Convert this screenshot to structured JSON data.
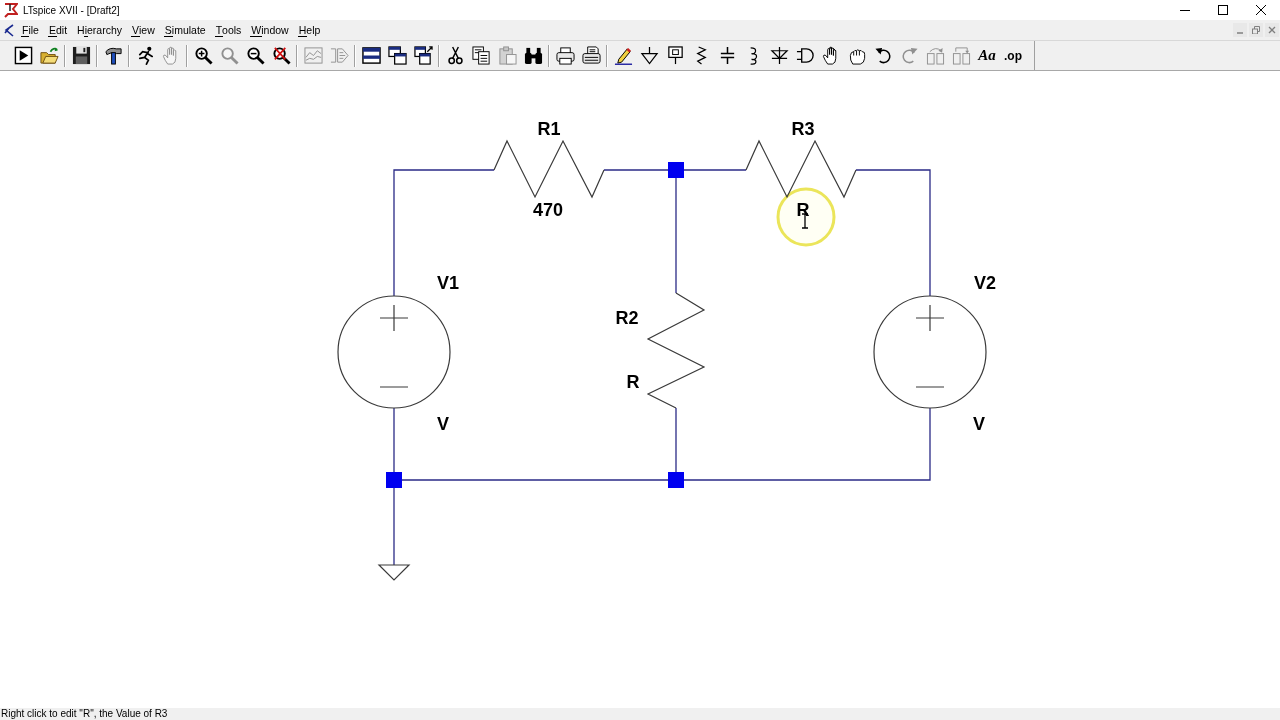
{
  "window": {
    "title": "LTspice XVII - [Draft2]"
  },
  "menu": [
    {
      "parts": [
        {
          "text": "F",
          "underlined": true
        },
        {
          "text": "ile",
          "underlined": false
        }
      ]
    },
    {
      "parts": [
        {
          "text": "E",
          "underlined": true
        },
        {
          "text": "dit",
          "underlined": false
        }
      ]
    },
    {
      "parts": [
        {
          "text": "H",
          "underlined": false
        },
        {
          "text": "i",
          "underlined": true
        },
        {
          "text": "erarchy",
          "underlined": false
        }
      ]
    },
    {
      "parts": [
        {
          "text": "V",
          "underlined": true
        },
        {
          "text": "iew",
          "underlined": false
        }
      ]
    },
    {
      "parts": [
        {
          "text": "S",
          "underlined": true
        },
        {
          "text": "imulate",
          "underlined": false
        }
      ]
    },
    {
      "parts": [
        {
          "text": "T",
          "underlined": true
        },
        {
          "text": "ools",
          "underlined": false
        }
      ]
    },
    {
      "parts": [
        {
          "text": "W",
          "underlined": true
        },
        {
          "text": "indow",
          "underlined": false
        }
      ]
    },
    {
      "parts": [
        {
          "text": "H",
          "underlined": true
        },
        {
          "text": "elp",
          "underlined": false
        }
      ]
    }
  ],
  "toolbar_groups": [
    {
      "buttons": [
        {
          "kind": "run",
          "disabled": false
        },
        {
          "kind": "open",
          "disabled": false
        }
      ]
    },
    {
      "buttons": [
        {
          "kind": "save",
          "disabled": false
        }
      ]
    },
    {
      "buttons": [
        {
          "kind": "control_panel",
          "disabled": false
        }
      ]
    },
    {
      "buttons": [
        {
          "kind": "halt",
          "disabled": false
        },
        {
          "kind": "pan",
          "disabled": true
        }
      ]
    },
    {
      "buttons": [
        {
          "kind": "zoom_in",
          "disabled": false
        },
        {
          "kind": "zoom_back",
          "disabled": true
        },
        {
          "kind": "zoom_out",
          "disabled": false
        },
        {
          "kind": "zoom_fit",
          "disabled": false
        }
      ]
    },
    {
      "buttons": [
        {
          "kind": "autorange",
          "disabled": true
        },
        {
          "kind": "graph_frame",
          "disabled": true
        }
      ]
    },
    {
      "buttons": [
        {
          "kind": "tile_h",
          "disabled": false
        },
        {
          "kind": "cascade",
          "disabled": false
        },
        {
          "kind": "tile_v",
          "disabled": false
        }
      ]
    },
    {
      "buttons": [
        {
          "kind": "cut",
          "disabled": false
        },
        {
          "kind": "copy",
          "disabled": false
        },
        {
          "kind": "paste",
          "disabled": true
        },
        {
          "kind": "find",
          "disabled": false
        }
      ]
    },
    {
      "buttons": [
        {
          "kind": "print",
          "disabled": false
        },
        {
          "kind": "print_setup",
          "disabled": false
        }
      ]
    },
    {
      "buttons": [
        {
          "kind": "wire",
          "disabled": false
        },
        {
          "kind": "ground",
          "disabled": false
        },
        {
          "kind": "label_net",
          "disabled": false
        },
        {
          "kind": "resistor",
          "disabled": false
        },
        {
          "kind": "capacitor",
          "disabled": false
        },
        {
          "kind": "inductor",
          "disabled": false
        },
        {
          "kind": "diode",
          "disabled": false
        },
        {
          "kind": "component",
          "disabled": false
        },
        {
          "kind": "move",
          "disabled": false
        },
        {
          "kind": "drag",
          "disabled": false
        },
        {
          "kind": "undo",
          "disabled": false
        },
        {
          "kind": "redo",
          "disabled": true
        },
        {
          "kind": "rotate",
          "disabled": true
        },
        {
          "kind": "mirror",
          "disabled": true
        },
        {
          "kind": "text",
          "label": "Aa",
          "disabled": false
        },
        {
          "kind": "directive",
          "label": ".op",
          "disabled": false
        }
      ]
    }
  ],
  "schematic": {
    "components": [
      {
        "kind": "resistor",
        "name": "R1",
        "value": "470"
      },
      {
        "kind": "resistor",
        "name": "R3",
        "value": "R"
      },
      {
        "kind": "voltage_source",
        "name": "V1",
        "value": "V"
      },
      {
        "kind": "resistor",
        "name": "R2",
        "value": "R"
      },
      {
        "kind": "voltage_source",
        "name": "V2",
        "value": "V"
      }
    ]
  },
  "status_bar": {
    "text": "Right click to edit \"R\", the Value of R3"
  }
}
